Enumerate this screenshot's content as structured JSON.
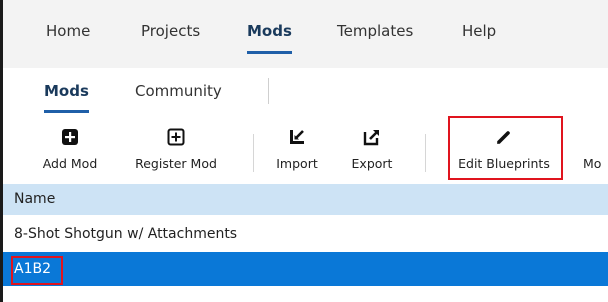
{
  "main_tabs": [
    "Home",
    "Projects",
    "Mods",
    "Templates",
    "Help"
  ],
  "main_tab_active": "Mods",
  "sub_tabs": [
    "Mods",
    "Community"
  ],
  "sub_tab_active": "Mods",
  "toolbar": {
    "add_mod": {
      "label": "Add Mod",
      "icon": "plus-square-icon"
    },
    "register_mod": {
      "label": "Register Mod",
      "icon": "plus-box-icon"
    },
    "import": {
      "label": "Import",
      "icon": "import-icon"
    },
    "export": {
      "label": "Export",
      "icon": "export-icon"
    },
    "edit_blueprints": {
      "label": "Edit Blueprints",
      "icon": "pencil-icon"
    },
    "overflow": {
      "label": "Mo"
    }
  },
  "table": {
    "header": "Name",
    "rows": [
      {
        "name": "8-Shot Shotgun w/ Attachments",
        "selected": false
      },
      {
        "name": "A1B2",
        "selected": true
      }
    ]
  },
  "colors": {
    "accent": "#1f5fa8",
    "header_bg": "#cde3f5",
    "selection": "#0a78d7",
    "highlight": "#e0141e"
  }
}
